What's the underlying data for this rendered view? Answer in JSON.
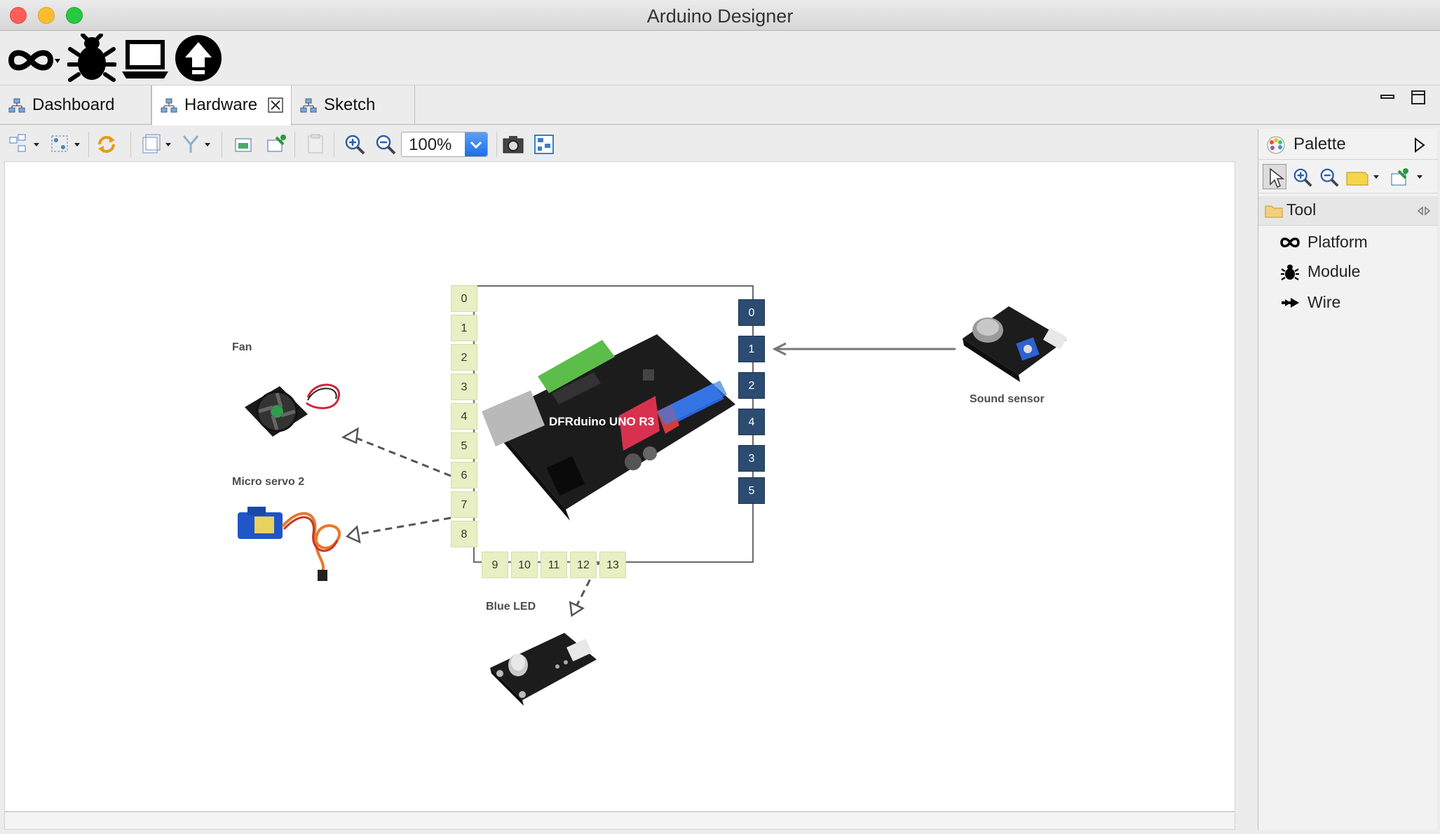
{
  "window": {
    "title": "Arduino Designer"
  },
  "main_toolbar": [
    "platform-menu",
    "debug",
    "serial-monitor",
    "upload"
  ],
  "tabs": [
    {
      "label": "Dashboard",
      "active": false,
      "closable": false
    },
    {
      "label": "Hardware",
      "active": true,
      "closable": true
    },
    {
      "label": "Sketch",
      "active": false,
      "closable": false
    }
  ],
  "diagram_toolbar": {
    "zoom": "100%"
  },
  "canvas": {
    "board": {
      "label": "DFRduino UNO R3",
      "left_pins": [
        "0",
        "1",
        "2",
        "3",
        "4",
        "5",
        "6",
        "7",
        "8"
      ],
      "bottom_pins": [
        "9",
        "10",
        "11",
        "12",
        "13"
      ],
      "right_pins": [
        "0",
        "1",
        "2",
        "4",
        "3",
        "5"
      ]
    },
    "modules": [
      {
        "label": "Fan"
      },
      {
        "label": "Micro servo 2"
      },
      {
        "label": "Blue LED"
      },
      {
        "label": "Sound sensor"
      }
    ]
  },
  "palette": {
    "title": "Palette",
    "drawer": "Tool",
    "items": [
      {
        "label": "Platform",
        "icon": "infinity-icon"
      },
      {
        "label": "Module",
        "icon": "bug-icon"
      },
      {
        "label": "Wire",
        "icon": "wire-arrow-icon"
      }
    ]
  },
  "colors": {
    "digital_pin": "#e7efc3",
    "analog_pin": "#2c4b70",
    "zoom_button": "#2f7cf0"
  }
}
